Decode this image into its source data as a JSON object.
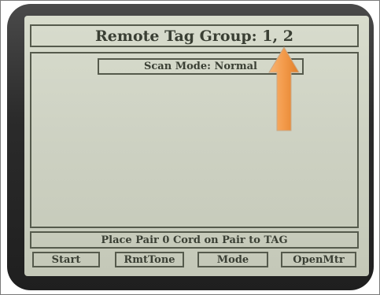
{
  "screen": {
    "title": "Remote Tag Group: 1, 2",
    "scan_mode": "Scan Mode: Normal",
    "status_message": "Place Pair 0 Cord on Pair to TAG"
  },
  "softkeys": {
    "start": "Start",
    "rmttone": "RmtTone",
    "mode": "Mode",
    "openmtr": "OpenMtr"
  },
  "annotation": {
    "arrow_color": "#f39a4a",
    "arrow_icon": "up-arrow-icon"
  },
  "colors": {
    "screen_bg": "#cdd1c2",
    "lcd_text": "#3a3f34",
    "bezel": "#2b2b2b"
  }
}
